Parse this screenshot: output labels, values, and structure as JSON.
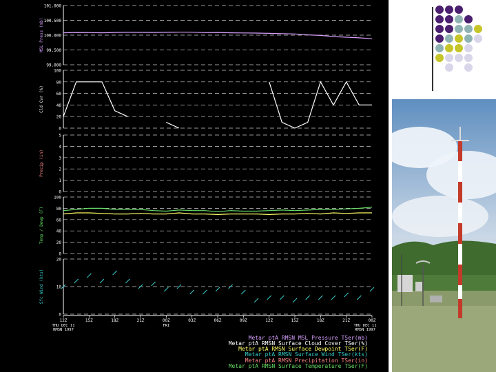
{
  "x_axis": {
    "ticks": [
      "12Z",
      "15Z",
      "18Z",
      "21Z",
      "00Z",
      "03Z",
      "06Z",
      "09Z",
      "12Z",
      "15Z",
      "18Z",
      "21Z",
      "00Z"
    ],
    "dates_first": [
      "THU",
      "DEC",
      "11"
    ],
    "dates_last": [
      "THU",
      "DEC",
      "11"
    ],
    "mid_date": "FRI",
    "series_id": "RMSN",
    "year": "1997"
  },
  "panels": [
    {
      "name": "pressure",
      "ylabel": "MSL Press (mb)",
      "color": "#d9a0ff",
      "ticks": [
        "101.000",
        "100.500",
        "100.000",
        "99.500",
        "99.000"
      ],
      "tick_values": [
        101000,
        100500,
        100000,
        99500,
        99000
      ]
    },
    {
      "name": "cloud",
      "ylabel": "Cld Cvr (%)",
      "color": "#ffffff",
      "ticks": [
        "100",
        "80",
        "60",
        "40",
        "20",
        "0"
      ],
      "tick_values": [
        100,
        80,
        60,
        40,
        20,
        0
      ]
    },
    {
      "name": "precip",
      "ylabel": "Precip (in)",
      "color": "#ff8888",
      "ticks": [
        "5",
        "4",
        "3",
        "2",
        "1",
        "0"
      ],
      "tick_values": [
        5,
        4,
        3,
        2,
        1,
        0
      ]
    },
    {
      "name": "temperature",
      "ylabel": "Temp / Dewp (F)",
      "color": "#66dd66",
      "ticks": [
        "100",
        "80",
        "60",
        "40",
        "20",
        "0"
      ],
      "tick_values": [
        100,
        80,
        60,
        40,
        20,
        0
      ]
    },
    {
      "name": "wind",
      "ylabel": "Sfc Wind (kts)",
      "color": "#33cccc",
      "ticks": [
        "20",
        "10",
        "0"
      ],
      "tick_values": [
        20,
        10,
        0
      ]
    }
  ],
  "chart_data": {
    "type": "line",
    "x": [
      0,
      1,
      2,
      3,
      4,
      5,
      6,
      7,
      8,
      9,
      10,
      11,
      12,
      13,
      14,
      15,
      16,
      17,
      18,
      19,
      20,
      21,
      22,
      23,
      24
    ],
    "series": [
      {
        "name": "Metar ptA RMSN MSL Pressure TSer(mb)",
        "color": "#d9a0ff",
        "values": [
          100080,
          100090,
          100085,
          100080,
          100090,
          100095,
          100092,
          100090,
          100095,
          100100,
          100098,
          100085,
          100090,
          100080,
          100075,
          100070,
          100060,
          100050,
          100040,
          100010,
          99990,
          99950,
          99930,
          99910,
          99880
        ]
      },
      {
        "name": "Metar ptA RMSN Surface Cloud Cover TSer(%)",
        "color": "#ffffff",
        "values": [
          20,
          80,
          80,
          80,
          30,
          20,
          null,
          null,
          10,
          0,
          null,
          null,
          null,
          null,
          0,
          null,
          80,
          10,
          0,
          10,
          80,
          40,
          80,
          40,
          40
        ]
      },
      {
        "name": "Metar ptA RMSN Surface Dewpoint TSer(F)",
        "color": "#ffff66",
        "values": [
          70,
          72,
          72,
          71,
          70,
          70,
          71,
          70,
          70,
          72,
          70,
          70,
          69,
          70,
          70,
          70,
          69,
          70,
          70,
          71,
          70,
          72,
          71,
          72,
          72
        ]
      },
      {
        "name": "Metar ptA RMSN Surface Wind TSer(kts)",
        "color": "#33cccc",
        "values": [
          10,
          12,
          14,
          12,
          15,
          12,
          10,
          11,
          9,
          10,
          8,
          8,
          9,
          10,
          8,
          5,
          6,
          6,
          5,
          6,
          6,
          6,
          7,
          6,
          9
        ]
      },
      {
        "name": "Metar ptA RMSN Precipitation TSer(in)",
        "color": "#ff8888",
        "values": []
      },
      {
        "name": "Metar ptA RMSN Surface Temperature TSer(F)",
        "color": "#66dd66",
        "values": [
          76,
          78,
          80,
          80,
          78,
          78,
          78,
          76,
          75,
          77,
          76,
          76,
          74,
          76,
          75,
          75,
          76,
          77,
          76,
          77,
          78,
          78,
          79,
          80,
          82
        ]
      }
    ]
  },
  "legend": [
    {
      "text": "Metar ptA RMSN MSL Pressure TSer(mb)",
      "color": "#d9a0ff"
    },
    {
      "text": "Metar ptA RMSN Surface Cloud Cover TSer(%)",
      "color": "#ffffff"
    },
    {
      "text": "Metar ptA RMSN Surface Dewpoint TSer(F)",
      "color": "#ffff66"
    },
    {
      "text": "Metar ptA RMSN Surface Wind TSer(kts)",
      "color": "#33cccc"
    },
    {
      "text": "Metar ptA RMSN Precipitation TSer(in)",
      "color": "#ff8888"
    },
    {
      "text": "Metar ptA RMSN Surface Temperature TSer(F)",
      "color": "#66dd66"
    }
  ],
  "decor": {
    "dot_colors": [
      "#4b1f6f",
      "#8fb3b3",
      "#c5c52a",
      "#d9d6ea"
    ]
  },
  "photo": {
    "subject": "weather station mast"
  }
}
